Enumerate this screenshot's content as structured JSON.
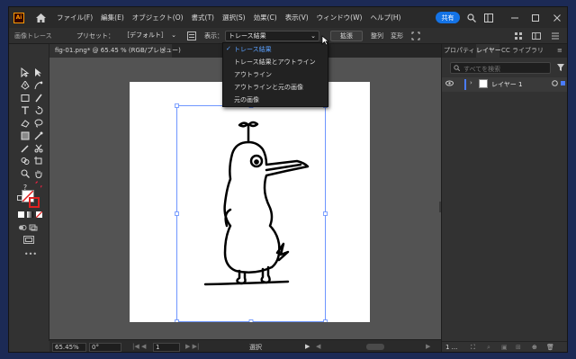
{
  "menubar": {
    "logo": "Ai",
    "items": [
      "ファイル(F)",
      "編集(E)",
      "オブジェクト(O)",
      "書式(T)",
      "選択(S)",
      "効果(C)",
      "表示(V)",
      "ウィンドウ(W)",
      "ヘルプ(H)"
    ],
    "share": "共有"
  },
  "control": {
    "panel_name": "画像トレース",
    "preset_label": "プリセット：",
    "preset_value": "［デフォルト］",
    "view_label": "表示：",
    "view_value": "トレース結果",
    "expand": "拡張",
    "arrange": "整列",
    "transform": "変形"
  },
  "document": {
    "tab_title": "fig-01.png* @ 65.45 % (RGB/プレビュー)",
    "close": "×"
  },
  "view_menu": {
    "items": [
      {
        "label": "トレース結果",
        "selected": true
      },
      {
        "label": "トレース結果とアウトライン",
        "selected": false
      },
      {
        "label": "アウトライン",
        "selected": false
      },
      {
        "label": "アウトラインと元の画像",
        "selected": false
      },
      {
        "label": "元の画像",
        "selected": false
      }
    ],
    "check": "✓"
  },
  "status": {
    "zoom": "65.45%",
    "rotation": "0°",
    "artboard_num": "1",
    "selection_label": "選択"
  },
  "panel": {
    "tabs": [
      "プロパティ",
      "レイヤー",
      "CC ライブラリ"
    ],
    "active_tab": "レイヤー",
    "search_placeholder": "すべてを検索",
    "layer_name": "レイヤー 1",
    "layer_count": "1 ..."
  },
  "colors": {
    "accent": "#1473e6",
    "selection": "#4a7cff",
    "canvas": "#535353"
  }
}
